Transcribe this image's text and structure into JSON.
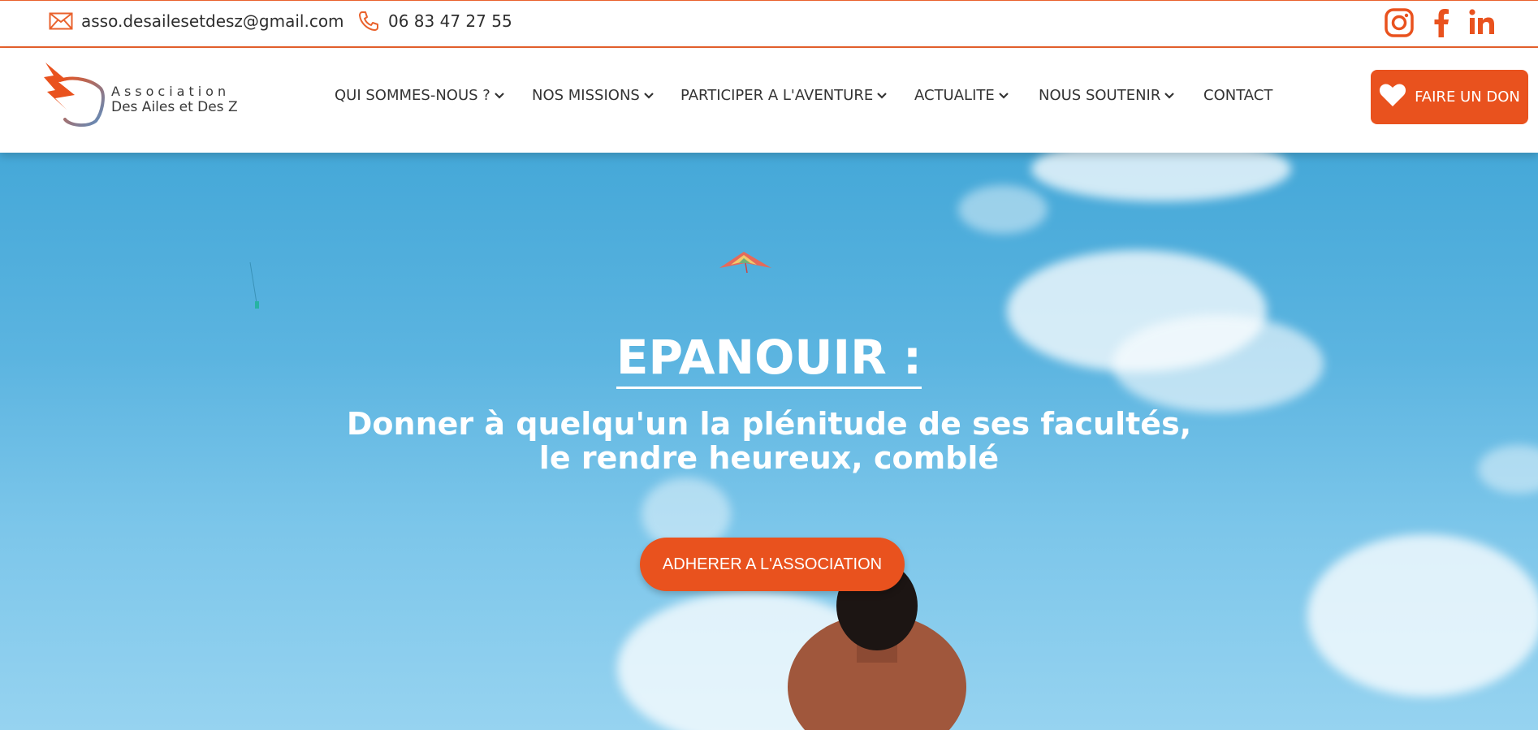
{
  "topbar": {
    "email": "asso.desailesetdesz@gmail.com",
    "phone": "06 83 47 27 55",
    "email_icon": "envelope-icon",
    "phone_icon": "phone-icon",
    "social": [
      "instagram-icon",
      "facebook-icon",
      "linkedin-icon"
    ]
  },
  "logo": {
    "line1": "Association",
    "line2": "Des Ailes et Des Z"
  },
  "nav": {
    "items": [
      {
        "label": "QUI SOMMES-NOUS ?",
        "dropdown": true
      },
      {
        "label": "NOS MISSIONS",
        "dropdown": true
      },
      {
        "label": "PARTICIPER A L'AVENTURE",
        "dropdown": true
      },
      {
        "label": "ACTUALITE",
        "dropdown": true
      },
      {
        "label": "NOUS SOUTENIR",
        "dropdown": true
      },
      {
        "label": "CONTACT",
        "dropdown": false
      }
    ]
  },
  "donate": {
    "label": "FAIRE UN DON",
    "icon": "heart-icon"
  },
  "hero": {
    "title": "EPANOUIR :",
    "subtitle_line1": "Donner à quelqu'un la plénitude de ses facultés,",
    "subtitle_line2": "le rendre heureux, comblé",
    "cta": "ADHERER A L'ASSOCIATION"
  },
  "colors": {
    "accent": "#e9521e",
    "border": "#e9622d",
    "text": "#333333",
    "sky_top": "#45a8d8",
    "sky_bottom": "#96d3f0"
  }
}
